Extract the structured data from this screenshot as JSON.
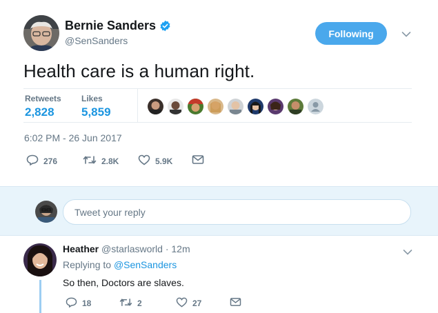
{
  "tweet": {
    "author": {
      "name": "Bernie Sanders",
      "handle": "@SenSanders",
      "verified": true
    },
    "follow_label": "Following",
    "text": "Health care is a human right.",
    "retweets_label": "Retweets",
    "retweets_count": "2,828",
    "likes_label": "Likes",
    "likes_count": "5,859",
    "timestamp": "6:02 PM - 26 Jun 2017",
    "actions": {
      "replies": "276",
      "retweets": "2.8K",
      "likes": "5.9K"
    }
  },
  "reply_box": {
    "placeholder": "Tweet your reply"
  },
  "reply": {
    "name": "Heather",
    "handle": "@starlasworld",
    "separator": "·",
    "time": "12m",
    "replying_prefix": "Replying to",
    "replying_to": "@SenSanders",
    "text": "So then, Doctors are slaves.",
    "actions": {
      "replies": "18",
      "retweets": "2",
      "likes": "27"
    }
  },
  "colors": {
    "accent": "#1b95e0",
    "follow_button": "#4aa8ec",
    "muted": "#657786",
    "reply_bg": "#e8f4fb"
  },
  "icons": [
    "verified-badge-icon",
    "chevron-down-icon",
    "reply-icon",
    "retweet-icon",
    "heart-icon",
    "envelope-icon"
  ]
}
